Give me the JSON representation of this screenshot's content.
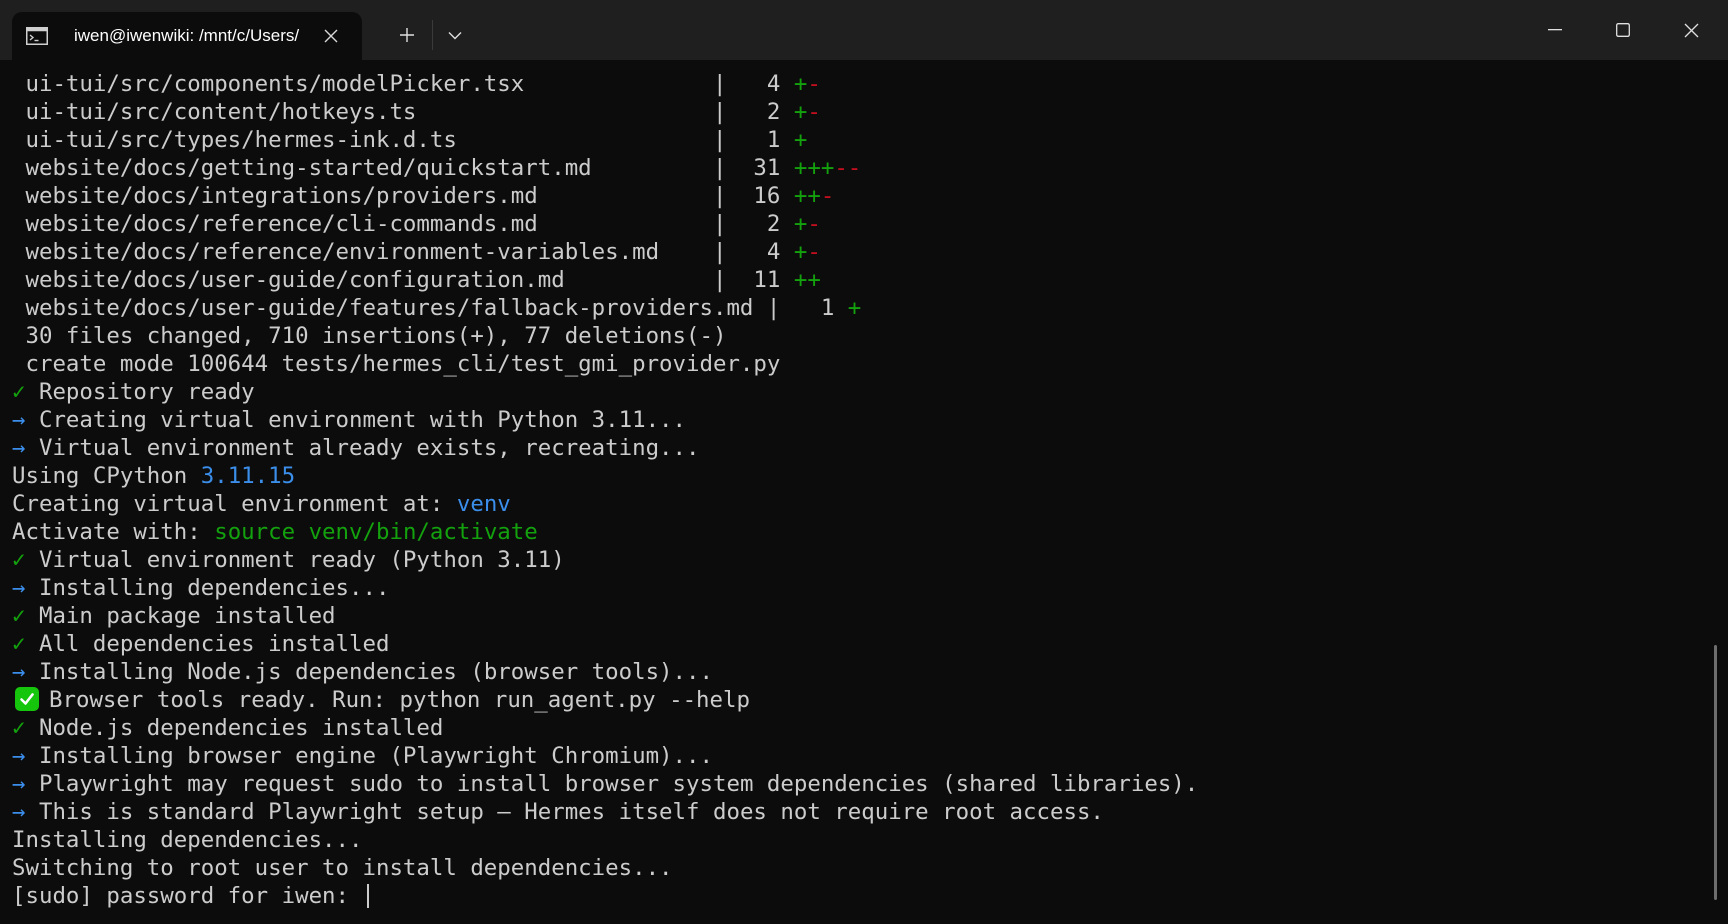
{
  "window": {
    "tab_title": "iwen@iwenwiki: /mnt/c/Users/",
    "tab_icon": "terminal-icon",
    "new_tab_icon": "plus-icon",
    "dropdown_icon": "chevron-down-icon",
    "controls": [
      "minimize-icon",
      "maximize-icon",
      "close-icon"
    ]
  },
  "colors": {
    "background": "#0c0c0c",
    "titlebar": "#1f1f1f",
    "text": "#cccccc",
    "green": "#13a10e",
    "red": "#c50f1f",
    "blue": "#3b8eea",
    "emoji_green": "#16c60c"
  },
  "terminal": {
    "lines": [
      [
        {
          "t": " ui-tui/src/components/modelPicker.tsx              |   4 "
        },
        {
          "t": "+",
          "c": "g"
        },
        {
          "t": "-",
          "c": "r"
        }
      ],
      [
        {
          "t": " ui-tui/src/content/hotkeys.ts                      |   2 "
        },
        {
          "t": "+",
          "c": "g"
        },
        {
          "t": "-",
          "c": "r"
        }
      ],
      [
        {
          "t": " ui-tui/src/types/hermes-ink.d.ts                   |   1 "
        },
        {
          "t": "+",
          "c": "g"
        }
      ],
      [
        {
          "t": " website/docs/getting-started/quickstart.md         |  31 "
        },
        {
          "t": "+++",
          "c": "g"
        },
        {
          "t": "--",
          "c": "r"
        }
      ],
      [
        {
          "t": " website/docs/integrations/providers.md             |  16 "
        },
        {
          "t": "++",
          "c": "g"
        },
        {
          "t": "-",
          "c": "r"
        }
      ],
      [
        {
          "t": " website/docs/reference/cli-commands.md             |   2 "
        },
        {
          "t": "+",
          "c": "g"
        },
        {
          "t": "-",
          "c": "r"
        }
      ],
      [
        {
          "t": " website/docs/reference/environment-variables.md    |   4 "
        },
        {
          "t": "+",
          "c": "g"
        },
        {
          "t": "-",
          "c": "r"
        }
      ],
      [
        {
          "t": " website/docs/user-guide/configuration.md           |  11 "
        },
        {
          "t": "++",
          "c": "g"
        }
      ],
      [
        {
          "t": " website/docs/user-guide/features/fallback-providers.md |   1 "
        },
        {
          "t": "+",
          "c": "g"
        }
      ],
      [
        {
          "t": " 30 files changed, 710 insertions(+), 77 deletions(-)"
        }
      ],
      [
        {
          "t": " create mode 100644 tests/hermes_cli/test_gmi_provider.py"
        }
      ],
      [
        {
          "t": "✓",
          "c": "g"
        },
        {
          "t": " Repository ready"
        }
      ],
      [
        {
          "t": "→",
          "c": "b"
        },
        {
          "t": " Creating virtual environment with Python 3.11..."
        }
      ],
      [
        {
          "t": "→",
          "c": "b"
        },
        {
          "t": " Virtual environment already exists, recreating..."
        }
      ],
      [
        {
          "t": "Using CPython "
        },
        {
          "t": "3.11.15",
          "c": "b"
        }
      ],
      [
        {
          "t": "Creating virtual environment at: "
        },
        {
          "t": "venv",
          "c": "b"
        }
      ],
      [
        {
          "t": "Activate with: "
        },
        {
          "t": "source venv/bin/activate",
          "c": "g"
        }
      ],
      [
        {
          "t": "✓",
          "c": "g"
        },
        {
          "t": " Virtual environment ready (Python 3.11)"
        }
      ],
      [
        {
          "t": "→",
          "c": "b"
        },
        {
          "t": " Installing dependencies..."
        }
      ],
      [
        {
          "t": "✓",
          "c": "g"
        },
        {
          "t": " Main package installed"
        }
      ],
      [
        {
          "t": "✓",
          "c": "g"
        },
        {
          "t": " All dependencies installed"
        }
      ],
      [
        {
          "t": "→",
          "c": "b"
        },
        {
          "t": " Installing Node.js dependencies (browser tools)..."
        }
      ],
      [
        {
          "icon": "check-mark-button-icon"
        },
        {
          "t": "Browser tools ready. Run: python run_agent.py --help"
        }
      ],
      [
        {
          "t": "✓",
          "c": "g"
        },
        {
          "t": " Node.js dependencies installed"
        }
      ],
      [
        {
          "t": "→",
          "c": "b"
        },
        {
          "t": " Installing browser engine (Playwright Chromium)..."
        }
      ],
      [
        {
          "t": "→",
          "c": "b"
        },
        {
          "t": " Playwright may request sudo to install browser system dependencies (shared libraries)."
        }
      ],
      [
        {
          "t": "→",
          "c": "b"
        },
        {
          "t": " This is standard Playwright setup — Hermes itself does not require root access."
        }
      ],
      [
        {
          "t": "Installing dependencies..."
        }
      ],
      [
        {
          "t": "Switching to root user to install dependencies..."
        }
      ],
      [
        {
          "t": "[sudo] password for iwen: "
        },
        {
          "cursor": true
        }
      ]
    ]
  }
}
